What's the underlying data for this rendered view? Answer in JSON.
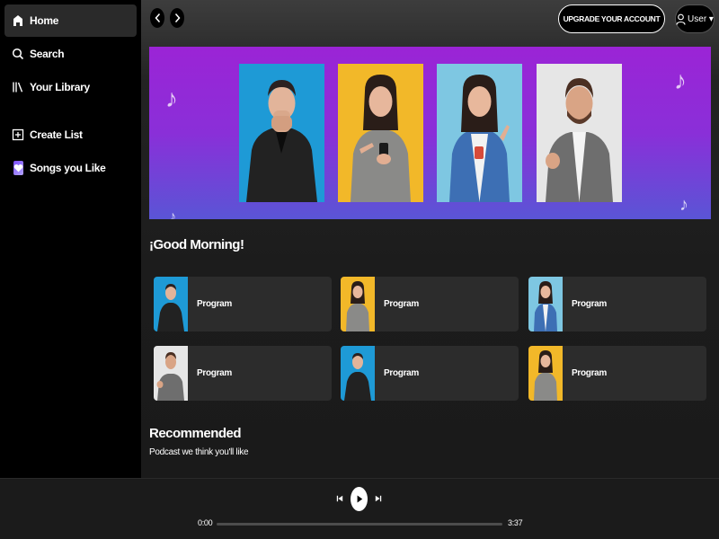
{
  "sidebar": {
    "items": [
      {
        "label": "Home",
        "icon": "home-icon",
        "active": true
      },
      {
        "label": "Search",
        "icon": "search-icon"
      },
      {
        "label": "Your Library",
        "icon": "library-icon"
      },
      {
        "label": "Create List",
        "icon": "plus-square-icon"
      },
      {
        "label": "Songs you Like",
        "icon": "heart-icon"
      }
    ]
  },
  "topbar": {
    "upgrade_label": "UPGRADE YOUR ACCOUNT",
    "user_label": "User ▾"
  },
  "greeting": {
    "title": "¡Good Morning!",
    "cards": [
      {
        "label": "Program",
        "thumb": "person-blue"
      },
      {
        "label": "Program",
        "thumb": "person-yellow"
      },
      {
        "label": "Program",
        "thumb": "person-lightblue"
      },
      {
        "label": "Program",
        "thumb": "person-gray"
      },
      {
        "label": "Program",
        "thumb": "person-blue"
      },
      {
        "label": "Program",
        "thumb": "person-yellow"
      }
    ]
  },
  "recommended": {
    "title": "Recommended",
    "subtitle": "Podcast we think you'll like"
  },
  "player": {
    "current_time": "0:00",
    "total_time": "3:37",
    "progress": 0
  },
  "colors": {
    "banner_top": "#9b24d6",
    "banner_bottom": "#5a55d6",
    "card_bg": "#2c2c2c"
  }
}
